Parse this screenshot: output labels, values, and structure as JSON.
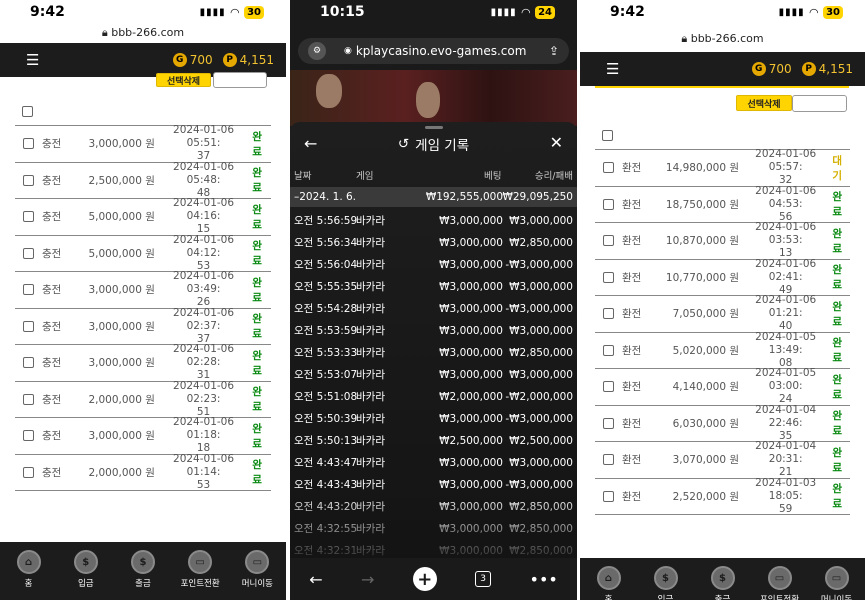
{
  "left": {
    "status": {
      "time": "9:42",
      "battery": "30"
    },
    "url": "bbb-266.com",
    "header": {
      "gold_badge": "G",
      "gold_points": "700",
      "point_badge": "P",
      "points": "4,151"
    },
    "delete_label": "선택삭제",
    "rows": [
      {
        "type": "충전",
        "amount": "3,000,000 원",
        "date": "2024-01-06 05:51:",
        "time_tail": "37",
        "status": "완료"
      },
      {
        "type": "충전",
        "amount": "2,500,000 원",
        "date": "2024-01-06 05:48:",
        "time_tail": "48",
        "status": "완료"
      },
      {
        "type": "충전",
        "amount": "5,000,000 원",
        "date": "2024-01-06 04:16:",
        "time_tail": "15",
        "status": "완료"
      },
      {
        "type": "충전",
        "amount": "5,000,000 원",
        "date": "2024-01-06 04:12:",
        "time_tail": "53",
        "status": "완료"
      },
      {
        "type": "충전",
        "amount": "3,000,000 원",
        "date": "2024-01-06 03:49:",
        "time_tail": "26",
        "status": "완료"
      },
      {
        "type": "충전",
        "amount": "3,000,000 원",
        "date": "2024-01-06 02:37:",
        "time_tail": "37",
        "status": "완료"
      },
      {
        "type": "충전",
        "amount": "3,000,000 원",
        "date": "2024-01-06 02:28:",
        "time_tail": "31",
        "status": "완료"
      },
      {
        "type": "충전",
        "amount": "2,000,000 원",
        "date": "2024-01-06 02:23:",
        "time_tail": "51",
        "status": "완료"
      },
      {
        "type": "충전",
        "amount": "3,000,000 원",
        "date": "2024-01-06 01:18:",
        "time_tail": "18",
        "status": "완료"
      },
      {
        "type": "충전",
        "amount": "2,000,000 원",
        "date": "2024-01-06 01:14:",
        "time_tail": "53",
        "status": "완료"
      }
    ],
    "nav": [
      {
        "label": "홈",
        "icon": "home-icon"
      },
      {
        "label": "입금",
        "icon": "deposit-icon"
      },
      {
        "label": "출금",
        "icon": "withdraw-icon"
      },
      {
        "label": "포인트전환",
        "icon": "point-exchange-icon"
      },
      {
        "label": "머니이동",
        "icon": "money-transfer-icon"
      }
    ]
  },
  "middle": {
    "status": {
      "time": "10:15",
      "battery": "24"
    },
    "url": "kplaycasino.evo-games.com",
    "sheet_title": "게임 기록",
    "columns": {
      "date": "날짜",
      "game": "게임",
      "bet": "베팅",
      "result": "승리/패배"
    },
    "summary": {
      "date": "–2024. 1. 6.",
      "bet": "₩192,555,000",
      "result": "₩29,095,250"
    },
    "rows": [
      {
        "time": "오전 5:56:59",
        "game": "바카라",
        "bet": "₩3,000,000",
        "result": "₩3,000,000"
      },
      {
        "time": "오전 5:56:34",
        "game": "바카라",
        "bet": "₩3,000,000",
        "result": "₩2,850,000"
      },
      {
        "time": "오전 5:56:04",
        "game": "바카라",
        "bet": "₩3,000,000",
        "result": "-₩3,000,000"
      },
      {
        "time": "오전 5:55:35",
        "game": "바카라",
        "bet": "₩3,000,000",
        "result": "₩3,000,000"
      },
      {
        "time": "오전 5:54:28",
        "game": "바카라",
        "bet": "₩3,000,000",
        "result": "-₩3,000,000"
      },
      {
        "time": "오전 5:53:59",
        "game": "바카라",
        "bet": "₩3,000,000",
        "result": "₩3,000,000"
      },
      {
        "time": "오전 5:53:33",
        "game": "바카라",
        "bet": "₩3,000,000",
        "result": "₩2,850,000"
      },
      {
        "time": "오전 5:53:07",
        "game": "바카라",
        "bet": "₩3,000,000",
        "result": "₩3,000,000"
      },
      {
        "time": "오전 5:51:08",
        "game": "바카라",
        "bet": "₩2,000,000",
        "result": "-₩2,000,000"
      },
      {
        "time": "오전 5:50:39",
        "game": "바카라",
        "bet": "₩3,000,000",
        "result": "-₩3,000,000"
      },
      {
        "time": "오전 5:50:13",
        "game": "바카라",
        "bet": "₩2,500,000",
        "result": "₩2,500,000"
      },
      {
        "time": "오전 4:43:47",
        "game": "바카라",
        "bet": "₩3,000,000",
        "result": "₩3,000,000"
      },
      {
        "time": "오전 4:43:43",
        "game": "바카라",
        "bet": "₩3,000,000",
        "result": "-₩3,000,000"
      },
      {
        "time": "오전 4:43:20",
        "game": "바카라",
        "bet": "₩3,000,000",
        "result": "₩2,850,000"
      },
      {
        "time": "오전 4:32:55",
        "game": "바카라",
        "bet": "₩3,000,000",
        "result": "₩2,850,000"
      },
      {
        "time": "오전 4:32:31",
        "game": "바카라",
        "bet": "₩3,000,000",
        "result": "₩2,850,000"
      }
    ],
    "tab_count": "3"
  },
  "right": {
    "status": {
      "time": "9:42",
      "battery": "30"
    },
    "url": "bbb-266.com",
    "header": {
      "gold_badge": "G",
      "gold_points": "700",
      "point_badge": "P",
      "points": "4,151"
    },
    "delete_label": "선택삭제",
    "rows": [
      {
        "type": "환전",
        "amount": "14,980,000 원",
        "date": "2024-01-06 05:57:",
        "time_tail": "32",
        "status": "대기",
        "waiting": true
      },
      {
        "type": "환전",
        "amount": "18,750,000 원",
        "date": "2024-01-06 04:53:",
        "time_tail": "56",
        "status": "완료"
      },
      {
        "type": "환전",
        "amount": "10,870,000 원",
        "date": "2024-01-06 03:53:",
        "time_tail": "13",
        "status": "완료"
      },
      {
        "type": "환전",
        "amount": "10,770,000 원",
        "date": "2024-01-06 02:41:",
        "time_tail": "49",
        "status": "완료"
      },
      {
        "type": "환전",
        "amount": "7,050,000 원",
        "date": "2024-01-06 01:21:",
        "time_tail": "40",
        "status": "완료"
      },
      {
        "type": "환전",
        "amount": "5,020,000 원",
        "date": "2024-01-05 13:49:",
        "time_tail": "08",
        "status": "완료"
      },
      {
        "type": "환전",
        "amount": "4,140,000 원",
        "date": "2024-01-05 03:00:",
        "time_tail": "24",
        "status": "완료"
      },
      {
        "type": "환전",
        "amount": "6,030,000 원",
        "date": "2024-01-04 22:46:",
        "time_tail": "35",
        "status": "완료"
      },
      {
        "type": "환전",
        "amount": "3,070,000 원",
        "date": "2024-01-04 20:31:",
        "time_tail": "21",
        "status": "완료"
      },
      {
        "type": "환전",
        "amount": "2,520,000 원",
        "date": "2024-01-03 18:05:",
        "time_tail": "59",
        "status": "완료"
      }
    ],
    "nav": [
      {
        "label": "홈",
        "icon": "home-icon"
      },
      {
        "label": "입금",
        "icon": "deposit-icon"
      },
      {
        "label": "출금",
        "icon": "withdraw-icon"
      },
      {
        "label": "포인트전환",
        "icon": "point-exchange-icon"
      },
      {
        "label": "머니이동",
        "icon": "money-transfer-icon"
      }
    ]
  }
}
